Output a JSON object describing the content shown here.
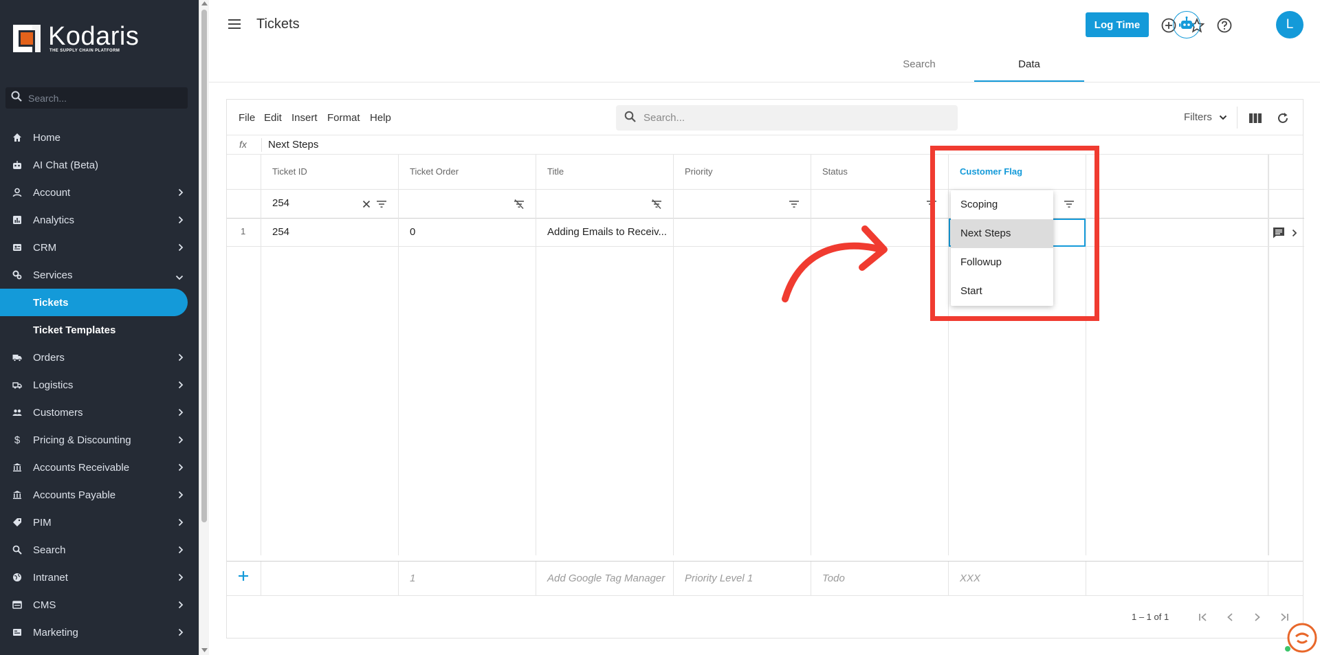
{
  "brand": {
    "name": "Kodaris",
    "tagline": "THE SUPPLY CHAIN PLATFORM"
  },
  "sidebar": {
    "search_placeholder": "Search...",
    "items": [
      {
        "label": "Home"
      },
      {
        "label": "AI Chat (Beta)"
      },
      {
        "label": "Account"
      },
      {
        "label": "Analytics"
      },
      {
        "label": "CRM"
      },
      {
        "label": "Services"
      },
      {
        "label": "Tickets"
      },
      {
        "label": "Ticket Templates"
      },
      {
        "label": "Orders"
      },
      {
        "label": "Logistics"
      },
      {
        "label": "Customers"
      },
      {
        "label": "Pricing & Discounting"
      },
      {
        "label": "Accounts Receivable"
      },
      {
        "label": "Accounts Payable"
      },
      {
        "label": "PIM"
      },
      {
        "label": "Search"
      },
      {
        "label": "Intranet"
      },
      {
        "label": "CMS"
      },
      {
        "label": "Marketing"
      }
    ]
  },
  "header": {
    "title": "Tickets",
    "log_time_label": "Log Time",
    "avatar_initial": "L",
    "tabs": [
      {
        "label": "Search"
      },
      {
        "label": "Data"
      }
    ],
    "active_tab": "Data"
  },
  "toolbar": {
    "menus": [
      "File",
      "Edit",
      "Insert",
      "Format",
      "Help"
    ],
    "search_placeholder": "Search...",
    "filters_label": "Filters"
  },
  "formula_bar": {
    "fx": "fx",
    "value": "Next Steps"
  },
  "grid": {
    "columns": [
      "Ticket ID",
      "Ticket Order",
      "Title",
      "Priority",
      "Status",
      "Customer Flag"
    ],
    "selected_column": "Customer Flag",
    "filter_values": {
      "ticket_id": "254"
    },
    "rows": [
      {
        "row_num": "1",
        "ticket_id": "254",
        "ticket_order": "0",
        "title": "Adding Emails to Receiv..."
      }
    ],
    "new_row_placeholders": {
      "ticket_order": "1",
      "title": "Add Google Tag Manager",
      "priority": "Priority Level 1",
      "status": "Todo",
      "customer_flag": "XXX"
    },
    "pager_text": "1 – 1 of 1"
  },
  "dropdown": {
    "options": [
      "Scoping",
      "Next Steps",
      "Followup",
      "Start"
    ],
    "highlighted": "Next Steps"
  },
  "colors": {
    "accent": "#149ad9",
    "sidebar_bg": "#252b35",
    "annotation": "#f03b30"
  }
}
